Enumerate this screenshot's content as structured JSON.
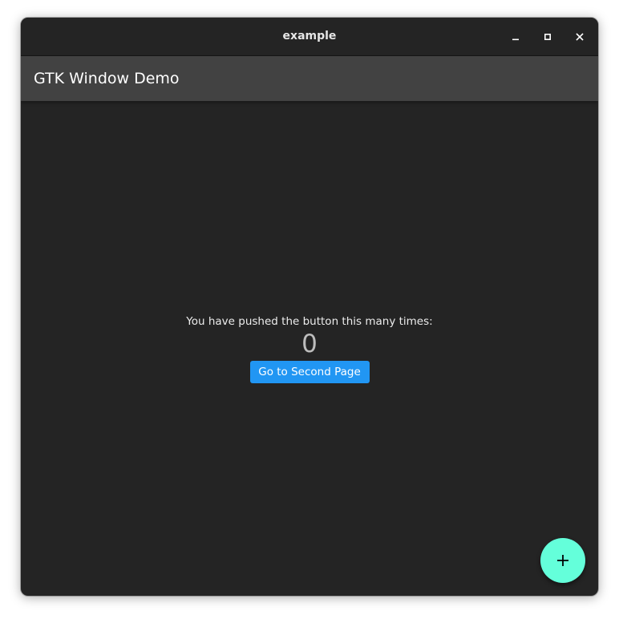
{
  "window": {
    "title": "example",
    "controls": {
      "minimize_icon": "minimize-icon",
      "maximize_icon": "maximize-icon",
      "close_icon": "close-icon"
    }
  },
  "appbar": {
    "title": "GTK Window Demo",
    "background": "#424242"
  },
  "main": {
    "counter_label": "You have pushed the button this many times:",
    "counter_value": "0",
    "go_button_label": "Go to Second Page",
    "go_button_color": "#2196f3"
  },
  "fab": {
    "icon": "plus-icon",
    "color": "#64ffda"
  },
  "theme": {
    "window_background": "#242424"
  }
}
